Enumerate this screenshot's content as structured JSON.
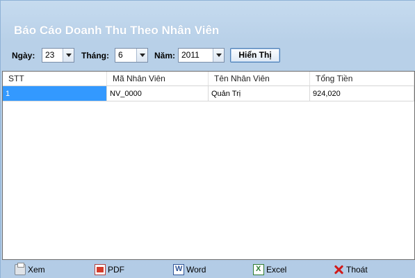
{
  "title": "Báo Cáo Doanh Thu Theo Nhân Viên",
  "filters": {
    "day_label": "Ngày:",
    "day_value": "23",
    "month_label": "Tháng:",
    "month_value": "6",
    "year_label": "Năm:",
    "year_value": "2011",
    "show_button": "Hiển Thị"
  },
  "grid": {
    "columns": [
      "STT",
      "Mã Nhân Viên",
      "Tên Nhân Viên",
      "Tổng Tiền"
    ],
    "rows": [
      [
        "1",
        "NV_0000",
        "Quản Trị",
        "924,020"
      ]
    ]
  },
  "toolbar": {
    "view": "Xem",
    "pdf": "PDF",
    "word": "Word",
    "excel": "Excel",
    "exit": "Thoát"
  },
  "icons": {
    "view": "printer-icon",
    "pdf": "pdf-icon",
    "word": "word-icon",
    "excel": "excel-icon",
    "exit": "close-icon"
  },
  "colors": {
    "background": "#bcd3ea",
    "selected_cell": "#3399ff",
    "title": "#ffffff"
  }
}
